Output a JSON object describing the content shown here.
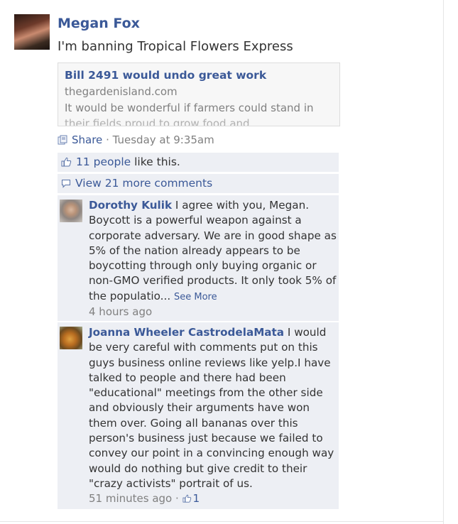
{
  "post": {
    "author": "Megan Fox",
    "status": "I'm banning Tropical Flowers Express",
    "link": {
      "title": "Bill 2491 would undo great work",
      "domain": "thegardenisland.com",
      "description": "It would be wonderful if farmers could stand in",
      "description_cut": "their fields proud to grow food and"
    },
    "share_label": "Share",
    "separator": " · ",
    "timestamp": "Tuesday at 9:35am"
  },
  "ufi": {
    "likes_link": "11 people",
    "likes_suffix": " like this.",
    "view_comments": "View 21 more comments"
  },
  "comments": [
    {
      "author": "Dorothy Kulik",
      "text": " I agree with you, Megan. Boycott is a powerful weapon against a corporate adversary. We are in good shape as 5% of the nation already appears to be boycotting through only buying organic or non-GMO verified products. It only took 5% of the populatio...",
      "see_more": "See More",
      "time": "4 hours ago"
    },
    {
      "author": "Joanna Wheeler CastrodelaMata",
      "text": " I would be very careful with comments put on this guys business online reviews like yelp.I have talked to people and there had been \"educational\" meetings from the other side and obviously their arguments have won them over. Going all bananas over this person's business just because we failed to convey our point in a convincing enough way would do nothing but give credit to their \"crazy activists\" portrait of us.",
      "time": "51 minutes ago",
      "separator": " · ",
      "like_count": "1"
    }
  ],
  "icons": {
    "share": "share-icon",
    "thumb": "thumbs-up-icon",
    "bubble": "comment-bubble-icon"
  },
  "colors": {
    "link": "#3b5998",
    "ufi_bg": "#edeff4",
    "muted": "#808080"
  }
}
